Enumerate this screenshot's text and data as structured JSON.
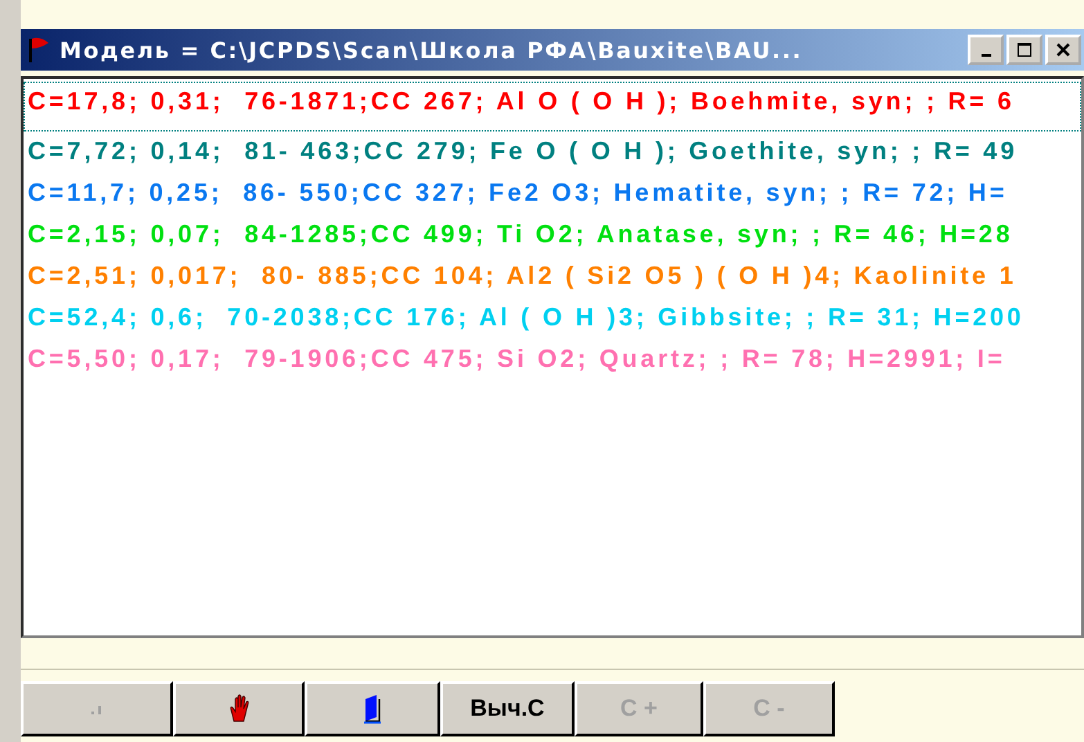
{
  "window": {
    "title": "Модель = C:\\JCPDS\\Scan\\Школа РФА\\Bauxite\\BAU..."
  },
  "rows": [
    {
      "text": "C=17,8; 0,31;  76-1871;CC 267; Al O ( O H ); Boehmite, syn; ; R= 6",
      "color": "#ff0000",
      "selected": true
    },
    {
      "text": "C=7,72; 0,14;  81- 463;CC 279; Fe O ( O H ); Goethite, syn; ; R= 49",
      "color": "#008080",
      "selected": false
    },
    {
      "text": "C=11,7; 0,25;  86- 550;CC 327; Fe2 O3; Hematite, syn; ; R= 72; H=",
      "color": "#0a78f0",
      "selected": false
    },
    {
      "text": "C=2,15; 0,07;  84-1285;CC 499; Ti O2; Anatase, syn; ; R= 46; H=28",
      "color": "#00e010",
      "selected": false
    },
    {
      "text": "C=2,51; 0,017;  80- 885;CC 104; Al2 ( Si2 O5 ) ( O H )4; Kaolinite 1",
      "color": "#ff8000",
      "selected": false
    },
    {
      "text": "C=52,4; 0,6;  70-2038;CC 176; Al ( O H )3; Gibbsite; ; R= 31; H=200",
      "color": "#00d0f0",
      "selected": false
    },
    {
      "text": "C=5,50; 0,17;  79-1906;CC 475; Si O2; Quartz; ; R= 78; H=2991; I=",
      "color": "#ff70b0",
      "selected": false
    }
  ],
  "buttons": [
    {
      "kind": "mark",
      "disabled": true
    },
    {
      "kind": "hand",
      "disabled": false
    },
    {
      "kind": "book",
      "disabled": false
    },
    {
      "kind": "text",
      "label": "Выч.С",
      "disabled": false
    },
    {
      "kind": "text",
      "label": "C +",
      "disabled": true
    },
    {
      "kind": "text",
      "label": "C -",
      "disabled": true
    }
  ]
}
